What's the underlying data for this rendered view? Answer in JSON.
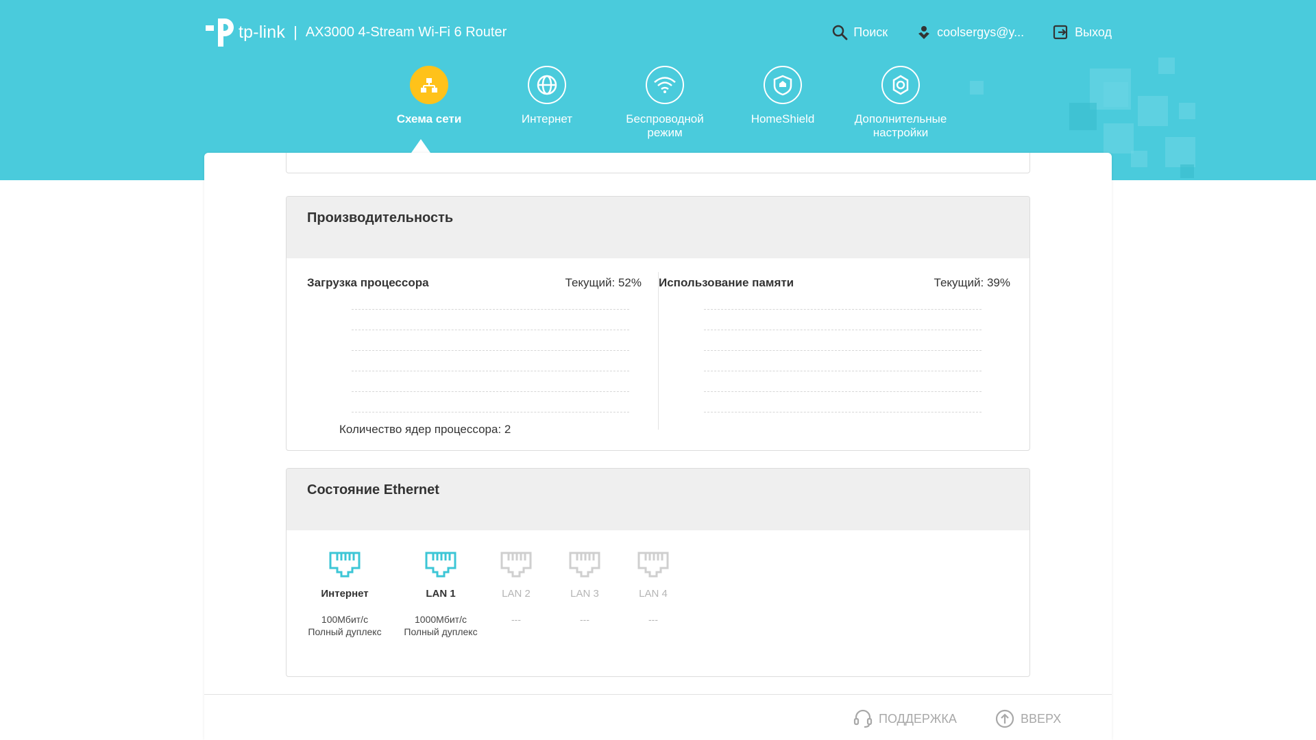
{
  "header": {
    "logo_text": "tp-link",
    "separator": "|",
    "model": "AX3000 4-Stream Wi-Fi 6 Router",
    "search_label": "Поиск",
    "account_label": "coolsergys@y...",
    "logout_label": "Выход"
  },
  "nav": {
    "items": [
      {
        "label": "Схема сети",
        "icon": "network-map-icon",
        "active": true
      },
      {
        "label": "Интернет",
        "icon": "globe-icon",
        "active": false
      },
      {
        "label": "Беспроводной режим",
        "icon": "wifi-icon",
        "active": false
      },
      {
        "label": "HomeShield",
        "icon": "shield-home-icon",
        "active": false
      },
      {
        "label": "Дополнительные настройки",
        "icon": "gear-icon",
        "active": false
      }
    ]
  },
  "performance": {
    "title": "Производительность",
    "cpu": {
      "title": "Загрузка процессора",
      "current": "Текущий: 52%",
      "value_percent": 52
    },
    "memory": {
      "title": "Использование памяти",
      "current": "Текущий: 39%",
      "value_percent": 39
    },
    "cores": "Количество ядер процессора: 2"
  },
  "ethernet": {
    "title": "Состояние Ethernet",
    "ports": [
      {
        "name": "Интернет",
        "speed": "100Мбит/с",
        "duplex": "Полный дуплекс",
        "connected": true
      },
      {
        "name": "LAN 1",
        "speed": "1000Мбит/с",
        "duplex": "Полный дуплекс",
        "connected": true
      },
      {
        "name": "LAN 2",
        "speed": "---",
        "duplex": "",
        "connected": false
      },
      {
        "name": "LAN 3",
        "speed": "---",
        "duplex": "",
        "connected": false
      },
      {
        "name": "LAN 4",
        "speed": "---",
        "duplex": "",
        "connected": false
      }
    ]
  },
  "footer": {
    "support_label": "ПОДДЕРЖКА",
    "top_label": "ВВЕРХ"
  },
  "colors": {
    "header_bg": "#4acbdc",
    "active_nav": "#ffc21a",
    "port_connected": "#3cc6d6",
    "port_disconnected": "#cfcfcf"
  }
}
